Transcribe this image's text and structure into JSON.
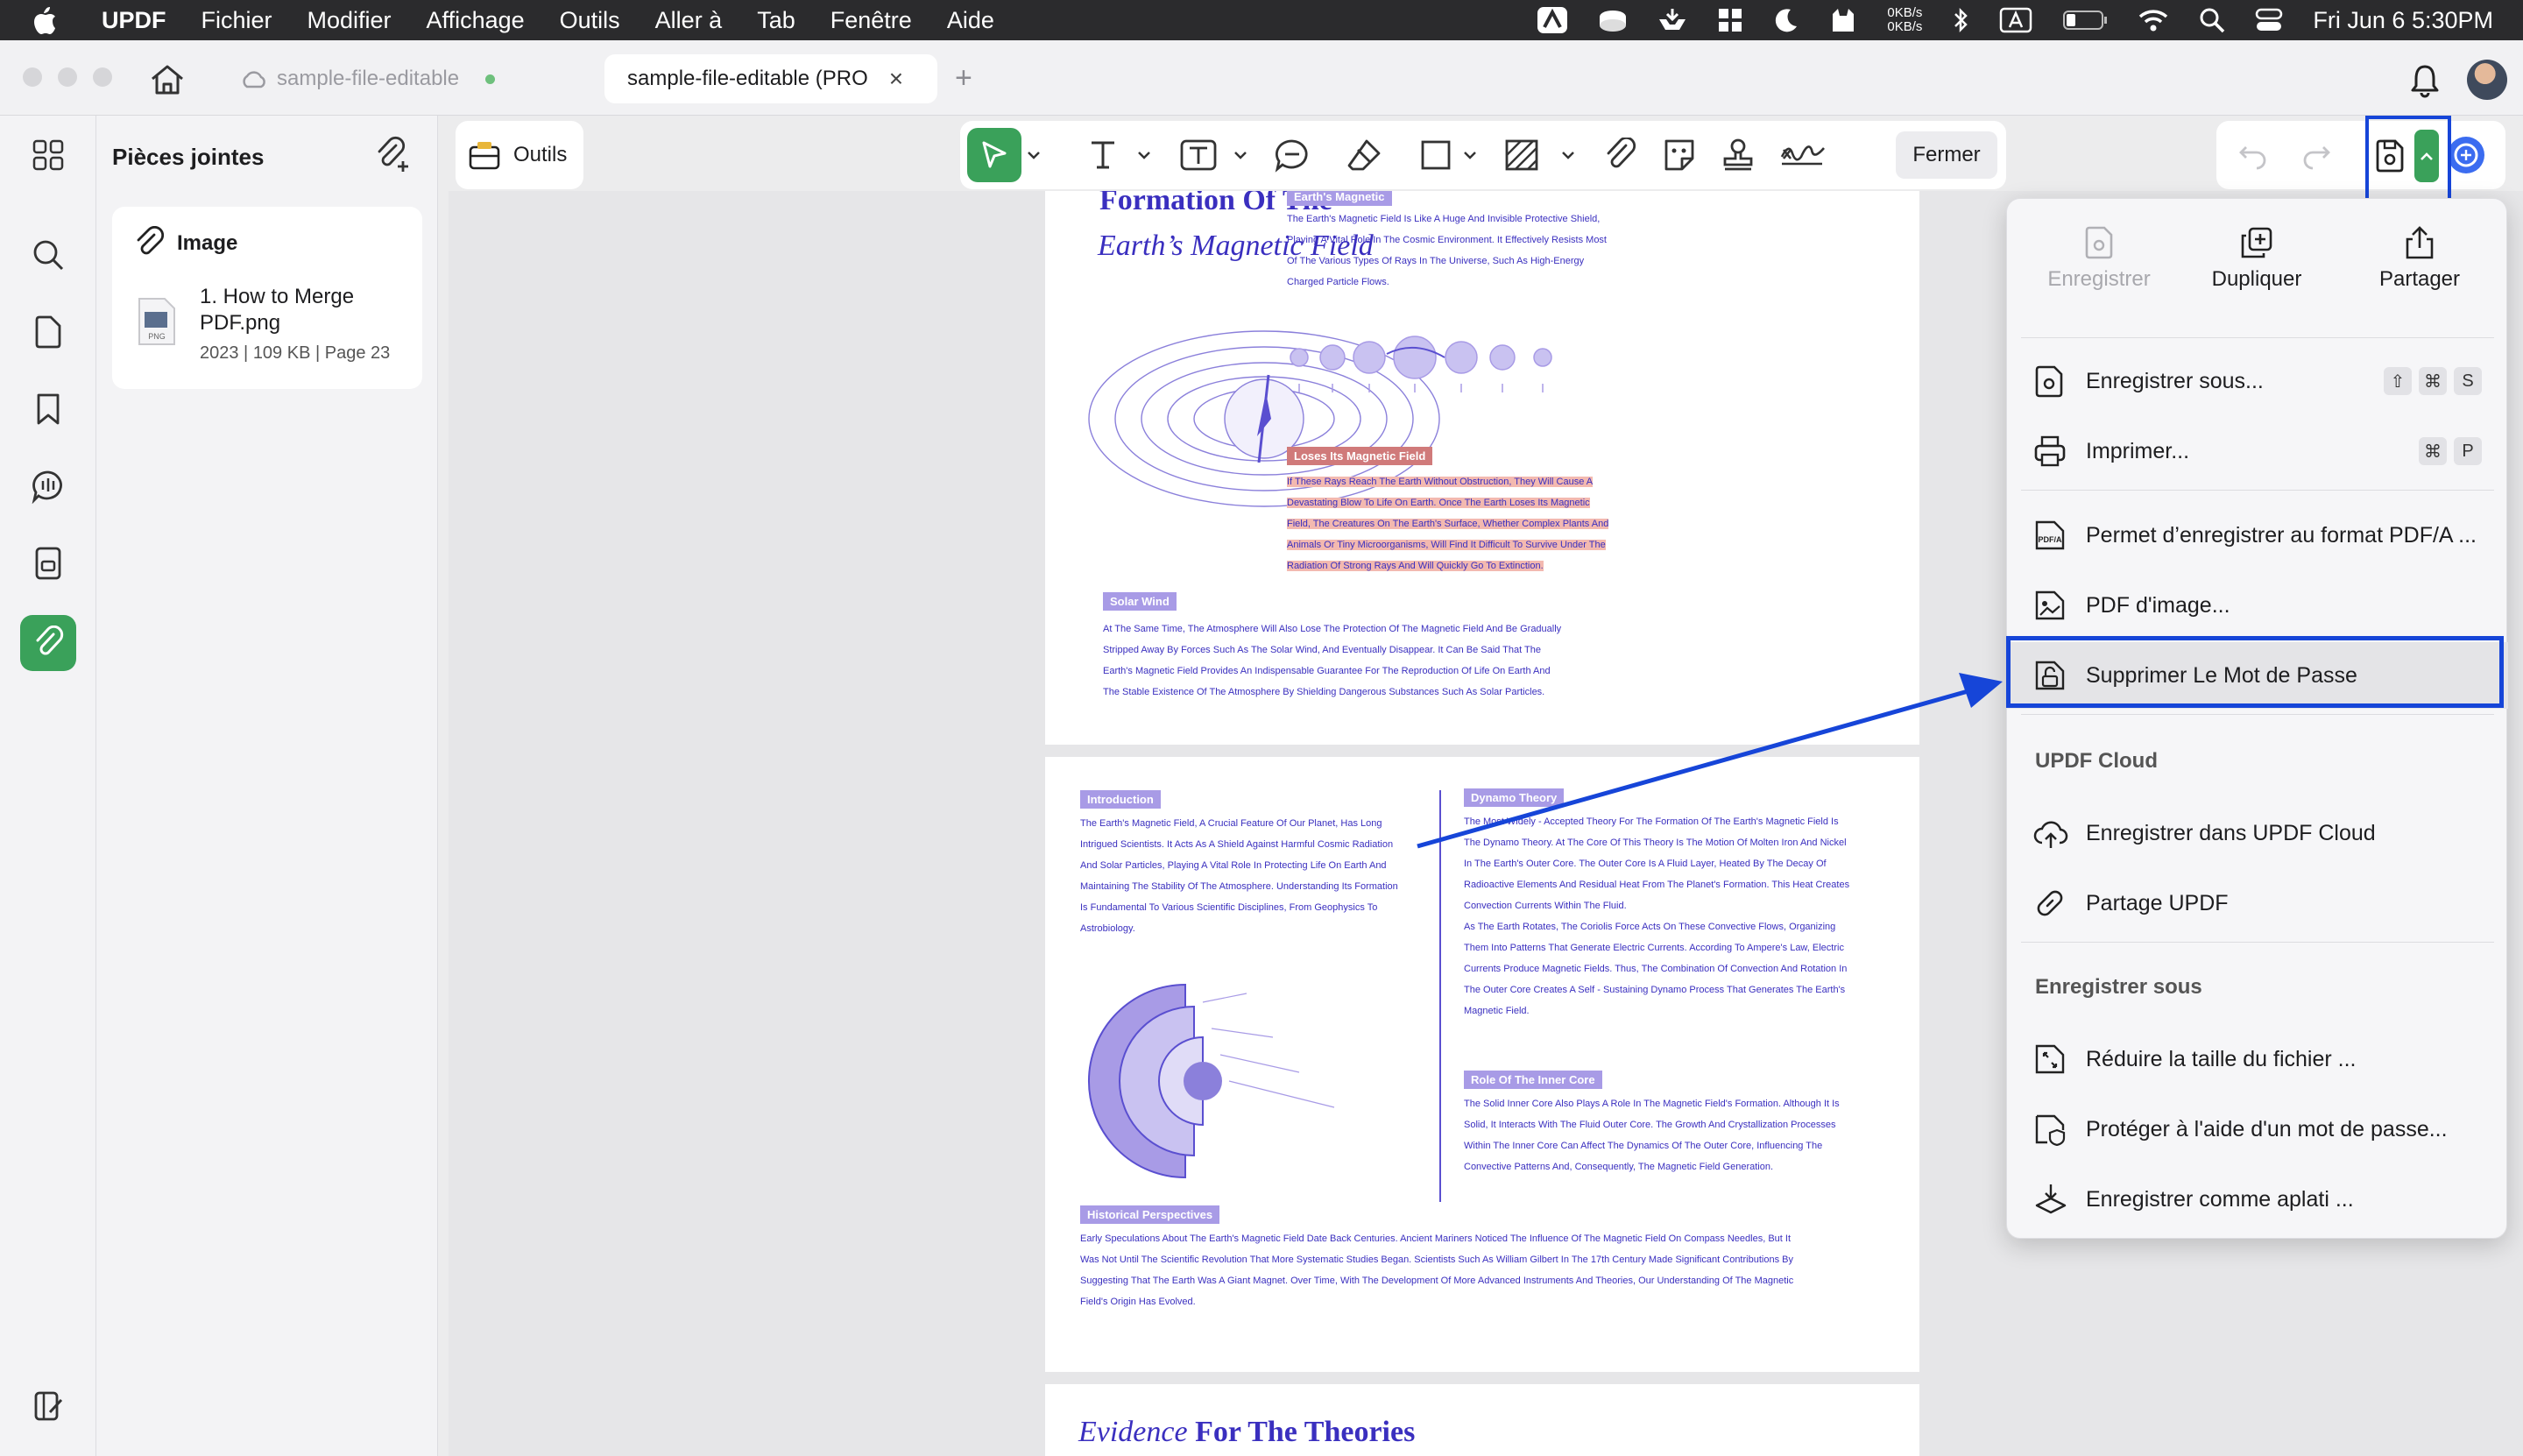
{
  "menubar": {
    "app": "UPDF",
    "items": [
      "Fichier",
      "Modifier",
      "Affichage",
      "Outils",
      "Aller à",
      "Tab",
      "Fenêtre",
      "Aide"
    ],
    "net_up": "0KB/s",
    "net_down": "0KB/s",
    "datetime": "Fri Jun 6  5:30PM"
  },
  "tabs": {
    "tab1": "sample-file-editable",
    "tab2": "sample-file-editable (PRO",
    "tab2_close": "×",
    "add": "+"
  },
  "attachments": {
    "title": "Pièces jointes",
    "group": "Image",
    "file_name": "1. How to Merge PDF.png",
    "year": "2023",
    "size": "109 KB",
    "page": "Page 23",
    "file_badge": "PNG"
  },
  "toolbar": {
    "outils": "Outils",
    "fermer": "Fermer"
  },
  "document": {
    "p1_title1": "Formation Of The",
    "p1_title2": "Earth’s Magnetic Field",
    "p1_tag_top": "Earth's Magnetic",
    "p1_text_top": [
      "The Earth's Magnetic Field Is Like A Huge And Invisible Protective Shield,",
      "Playing A Vital Role In The Cosmic Environment. It Effectively Resists Most",
      "Of The Various Types Of Rays In The Universe, Such As High-Energy",
      "Charged Particle Flows."
    ],
    "p1_tag_loses": "Loses Its Magnetic Field",
    "p1_text_loses": [
      "If These Rays Reach The Earth Without Obstruction, They Will Cause A",
      "Devastating Blow To Life On Earth. Once The Earth Loses Its Magnetic",
      "Field, The Creatures On The Earth's Surface, Whether Complex Plants And",
      "Animals Or Tiny Microorganisms, Will Find It Difficult To Survive Under The",
      "Radiation Of Strong Rays And Will Quickly Go To Extinction."
    ],
    "p1_tag_solar": "Solar Wind",
    "p1_text_solar": [
      "At The Same Time, The Atmosphere Will Also Lose The Protection Of The Magnetic Field And Be Gradually",
      "Stripped Away By Forces Such As The Solar Wind, And Eventually Disappear. It Can Be Said That The",
      "Earth's Magnetic Field Provides An Indispensable Guarantee For The Reproduction Of Life On Earth And",
      "The Stable Existence Of The Atmosphere By Shielding Dangerous Substances Such As Solar Particles."
    ],
    "p2_tag_intro": "Introduction",
    "p2_text_intro": [
      "The Earth's Magnetic Field, A Crucial Feature Of Our Planet, Has Long",
      "Intrigued Scientists. It Acts As A Shield Against Harmful Cosmic Radiation",
      "And Solar Particles, Playing A Vital Role In Protecting Life On Earth And",
      "Maintaining The Stability Of The Atmosphere. Understanding Its Formation",
      "Is Fundamental To Various Scientific Disciplines, From Geophysics To",
      "Astrobiology."
    ],
    "p2_tag_dynamo": "Dynamo Theory",
    "p2_text_dynamo": [
      "The Most Widely - Accepted Theory For The Formation Of The Earth's Magnetic Field Is",
      "The Dynamo Theory. At The Core Of This Theory Is The Motion Of Molten Iron And Nickel",
      "In The Earth's Outer Core. The Outer Core Is A Fluid Layer, Heated By The Decay Of",
      "Radioactive Elements And Residual Heat From The Planet's Formation. This Heat Creates",
      "Convection Currents Within The Fluid.",
      "As The Earth Rotates, The Coriolis Force Acts On These Convective Flows, Organizing",
      "Them Into Patterns That Generate Electric Currents. According To Ampere's Law, Electric",
      "Currents Produce Magnetic Fields. Thus, The Combination Of Convection And Rotation In",
      "The Outer Core Creates A Self - Sustaining Dynamo Process That Generates The Earth's",
      "Magnetic Field."
    ],
    "p2_tag_inner": "Role Of The Inner Core",
    "p2_text_inner": [
      "The Solid Inner Core Also Plays A Role In The Magnetic Field's Formation. Although It Is",
      "Solid, It Interacts With The Fluid Outer Core. The Growth And Crystallization Processes",
      "Within The Inner Core Can Affect The Dynamics Of The Outer Core, Influencing The",
      "Convective Patterns And, Consequently, The Magnetic Field Generation."
    ],
    "p2_tag_hist": "Historical Perspectives",
    "p2_text_hist": [
      "Early Speculations About The Earth's Magnetic Field Date Back Centuries. Ancient Mariners Noticed The Influence Of The Magnetic Field On Compass Needles, But It",
      "Was Not Until The Scientific Revolution That More Systematic Studies Began. Scientists Such As William Gilbert In The 17th Century Made Significant Contributions By",
      "Suggesting That The Earth Was A Giant Magnet. Over Time, With The Development Of More Advanced Instruments And Theories, Our Understanding Of The Magnetic",
      "Field's Origin Has Evolved."
    ],
    "p3_title_a": "Evidence",
    "p3_title_b": " For The Theories"
  },
  "menu": {
    "top": [
      {
        "label": "Enregistrer",
        "disabled": true
      },
      {
        "label": "Dupliquer",
        "disabled": false
      },
      {
        "label": "Partager",
        "disabled": false
      }
    ],
    "rows": [
      {
        "id": "save-as",
        "label": "Enregistrer sous...",
        "keys": [
          "⇧",
          "⌘",
          "S"
        ]
      },
      {
        "id": "print",
        "label": "Imprimer...",
        "keys": [
          "⌘",
          "P"
        ]
      },
      {
        "id": "pdfa",
        "label": "Permet d’enregistrer au format PDF/A ..."
      },
      {
        "id": "pdf-image",
        "label": "PDF d'image..."
      },
      {
        "id": "remove-password",
        "label": "Supprimer Le Mot de Passe"
      },
      {
        "id": "save-cloud",
        "label": "Enregistrer dans UPDF Cloud"
      },
      {
        "id": "share-updf",
        "label": "Partage UPDF"
      },
      {
        "id": "reduce-size",
        "label": "Réduire la taille du fichier ..."
      },
      {
        "id": "protect-password",
        "label": "Protéger à l'aide d'un mot de passe..."
      },
      {
        "id": "flatten",
        "label": "Enregistrer comme aplati ..."
      }
    ],
    "section_cloud": "UPDF Cloud",
    "section_save": "Enregistrer sous"
  },
  "colors": {
    "accent_green": "#3aa15a",
    "highlight_blue": "#1645d8",
    "doc_purple": "#3a2fbf"
  }
}
